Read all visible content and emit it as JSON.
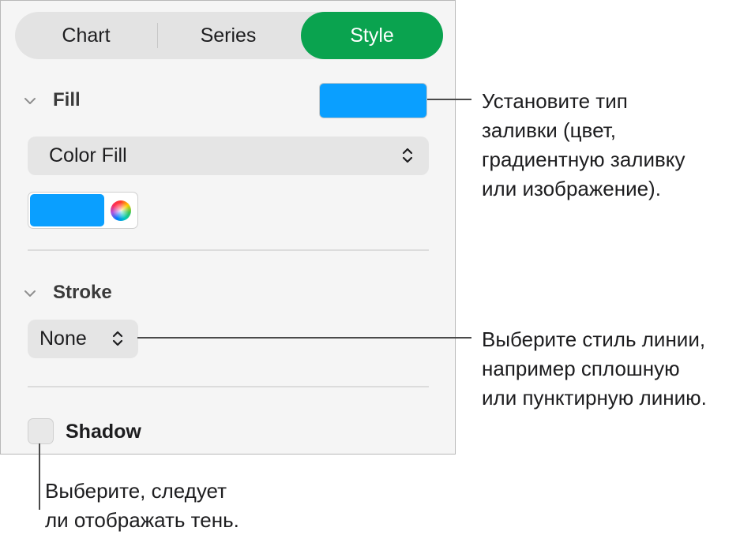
{
  "tabs": [
    {
      "label": "Chart",
      "selected": false
    },
    {
      "label": "Series",
      "selected": false
    },
    {
      "label": "Style",
      "selected": true
    }
  ],
  "fill": {
    "heading": "Fill",
    "swatch_color": "#0a9fff",
    "type_selected": "Color Fill",
    "well_color": "#0a9fff"
  },
  "stroke": {
    "heading": "Stroke",
    "style_selected": "None"
  },
  "shadow": {
    "label": "Shadow",
    "checked": false
  },
  "callouts": {
    "fill": [
      "Установите тип",
      "заливки (цвет,",
      "градиентную заливку",
      "или изображение)."
    ],
    "stroke": [
      "Выберите стиль линии,",
      "например сплошную",
      "или пунктирную линию."
    ],
    "shadow": [
      "Выберите, следует",
      "ли отображать тень."
    ]
  },
  "colors": {
    "accent": "#0aa34f",
    "fill_blue": "#0a9fff"
  }
}
